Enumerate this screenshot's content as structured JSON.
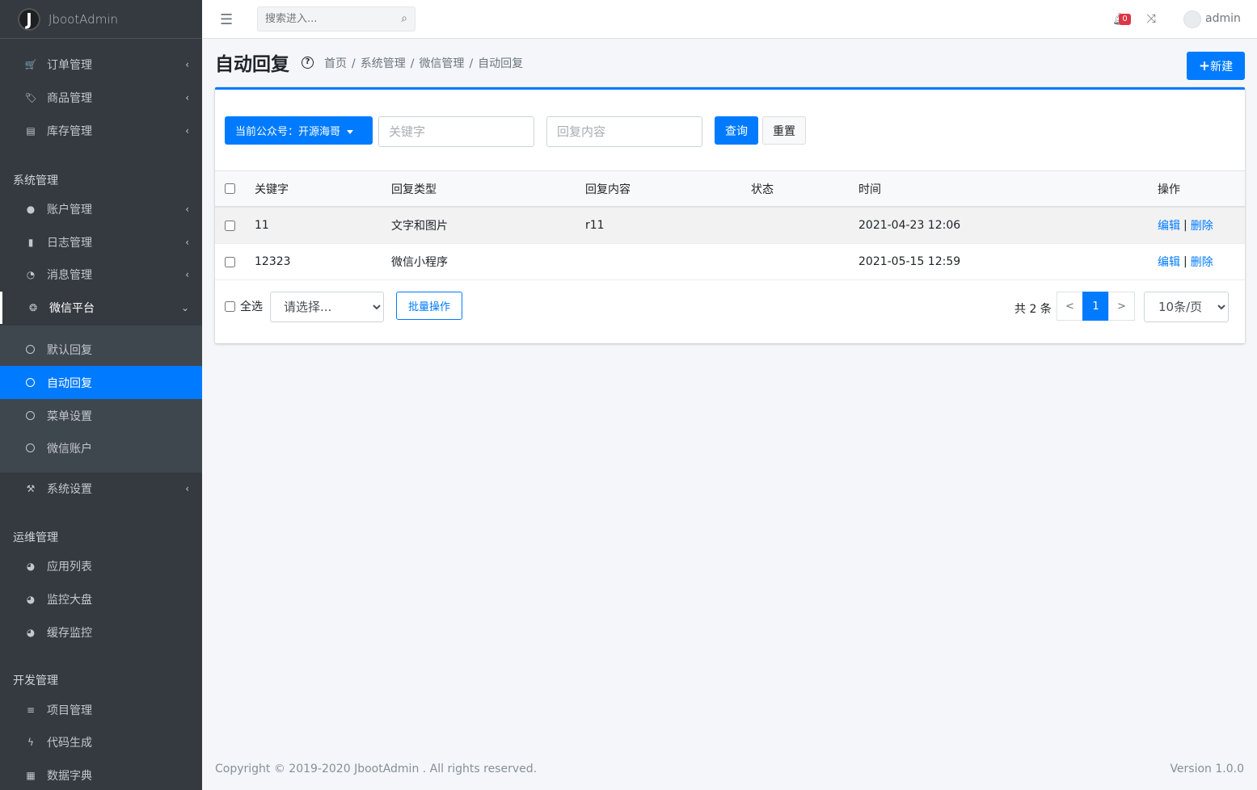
{
  "brand": {
    "logo_letter": "J",
    "name": "JbootAdmin"
  },
  "sidebar": {
    "top_items": [
      {
        "icon": "cart-icon",
        "glyph": "🛒",
        "label": "订单管理"
      },
      {
        "icon": "tag-icon",
        "glyph": "🏷",
        "label": "商品管理"
      },
      {
        "icon": "warehouse-icon",
        "glyph": "▤",
        "label": "库存管理"
      }
    ],
    "section_system": "系统管理",
    "system_items": [
      {
        "icon": "user-icon",
        "glyph": "●",
        "label": "账户管理"
      },
      {
        "icon": "book-icon",
        "glyph": "▮",
        "label": "日志管理"
      },
      {
        "icon": "satellite-icon",
        "glyph": "◔",
        "label": "消息管理"
      }
    ],
    "wechat": {
      "icon": "wechat-icon",
      "glyph": "❂",
      "label": "微信平台"
    },
    "wechat_sub": [
      {
        "label": "默认回复",
        "active": false
      },
      {
        "label": "自动回复",
        "active": true
      },
      {
        "label": "菜单设置",
        "active": false
      },
      {
        "label": "微信账户",
        "active": false
      }
    ],
    "settings": {
      "icon": "hammer-icon",
      "glyph": "⚒",
      "label": "系统设置"
    },
    "section_ops": "运维管理",
    "ops_items": [
      {
        "icon": "dashboard-icon",
        "glyph": "◕",
        "label": "应用列表"
      },
      {
        "icon": "dashboard-icon",
        "glyph": "◕",
        "label": "监控大盘"
      },
      {
        "icon": "dashboard-icon",
        "glyph": "◕",
        "label": "缓存监控"
      }
    ],
    "section_dev": "开发管理",
    "dev_items": [
      {
        "icon": "database-icon",
        "glyph": "≡",
        "label": "项目管理"
      },
      {
        "icon": "bolt-icon",
        "glyph": "ϟ",
        "label": "代码生成"
      },
      {
        "icon": "grid-icon",
        "glyph": "▦",
        "label": "数据字典"
      }
    ]
  },
  "topbar": {
    "search_placeholder": "搜索进入...",
    "notification_count": "0",
    "username": "admin"
  },
  "page": {
    "title": "自动回复",
    "breadcrumb": [
      "首页",
      "系统管理",
      "微信管理",
      "自动回复"
    ],
    "new_button": "新建"
  },
  "filters": {
    "account_button": "当前公众号：开源海哥",
    "keyword_placeholder": "关键字",
    "content_placeholder": "回复内容",
    "query_button": "查询",
    "reset_button": "重置"
  },
  "table": {
    "headers": [
      "关键字",
      "回复类型",
      "回复内容",
      "状态",
      "时间",
      "操作"
    ],
    "rows": [
      {
        "keyword": "11",
        "type": "文字和图片",
        "content": "r11",
        "status": "",
        "time": "2021-04-23 12:06",
        "edit": "编辑",
        "delete": "删除"
      },
      {
        "keyword": "12323",
        "type": "微信小程序",
        "content": "",
        "status": "",
        "time": "2021-05-15 12:59",
        "edit": "编辑",
        "delete": "删除"
      }
    ]
  },
  "footer_bar": {
    "select_all": "全选",
    "batch_select": "请选择...",
    "batch_button": "批量操作",
    "total": "共 2 条",
    "prev": "<",
    "current_page": "1",
    "next": ">",
    "page_size": "10条/页"
  },
  "footer": {
    "copyright": "Copyright © 2019-2020 JbootAdmin . All rights reserved.",
    "version": "Version 1.0.0"
  }
}
